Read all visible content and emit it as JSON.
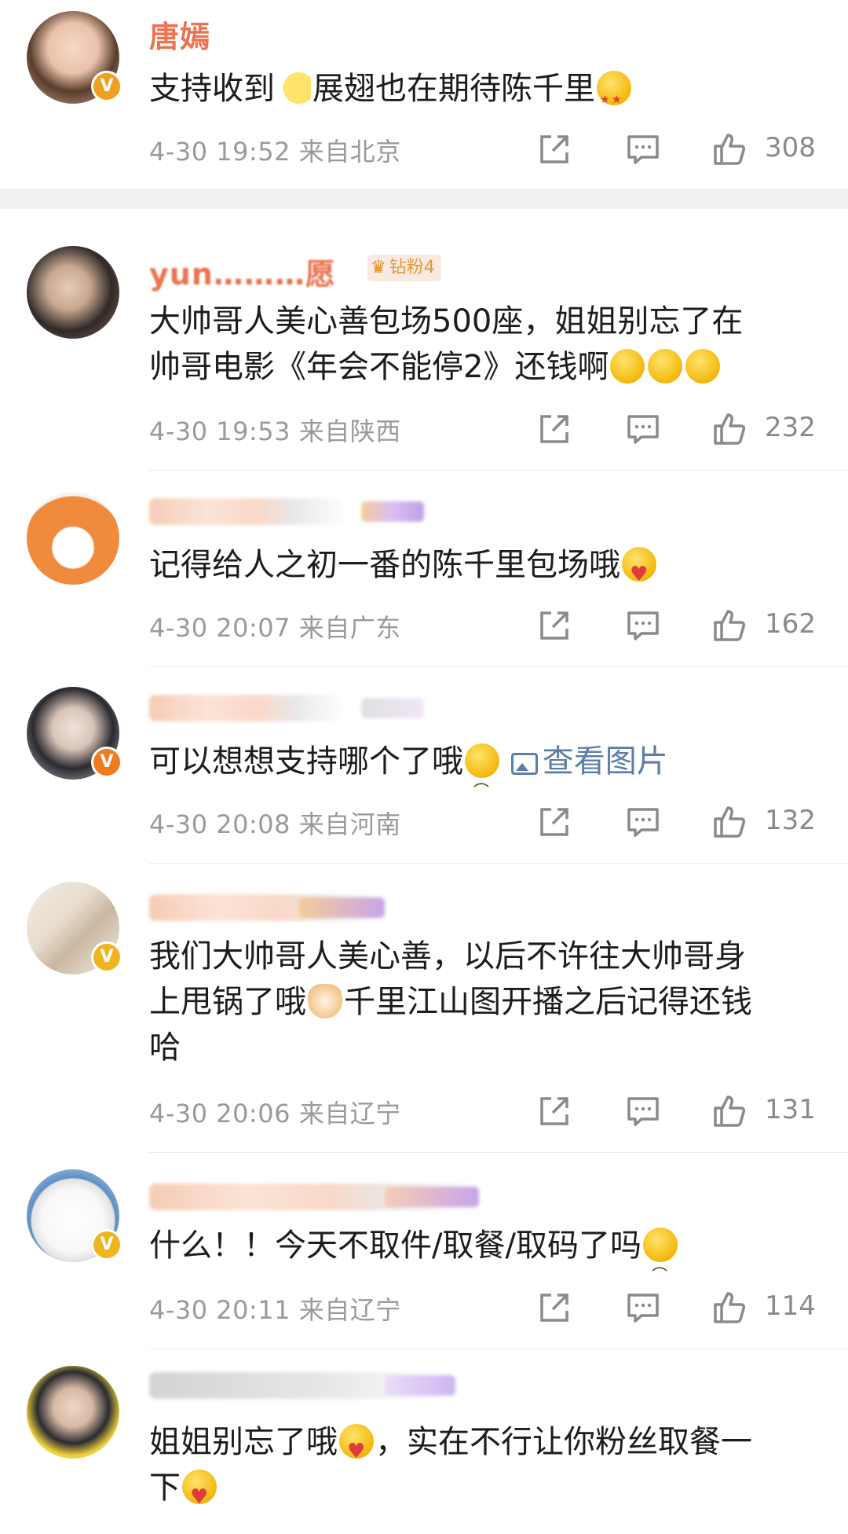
{
  "comments": [
    {
      "name": "唐嫣",
      "text_parts": [
        "支持收到",
        "展翅也在期待陈千里",
        ""
      ],
      "time": "4-30 19:52",
      "location": "来自北京",
      "likes": "308",
      "verified": true,
      "verified_color": "#f0a01e"
    },
    {
      "name": "yun………愿",
      "fan_badge": "钻粉4",
      "text_line1": "大帅哥人美心善包场500座，姐姐别忘了在",
      "text_line2": "帅哥电影《年会不能停2》还钱啊",
      "time": "4-30 19:53",
      "location": "来自陕西",
      "likes": "232"
    },
    {
      "text": "记得给人之初一番的陈千里包场哦",
      "time": "4-30 20:07",
      "location": "来自广东",
      "likes": "162"
    },
    {
      "text": "可以想想支持哪个了哦",
      "image_link": "查看图片",
      "time": "4-30 20:08",
      "location": "来自河南",
      "likes": "132",
      "verified_color": "#f07c1e"
    },
    {
      "text_line1": "我们大帅哥人美心善，以后不许往大帅哥身",
      "text_line2a": "上甩锅了哦",
      "text_line2b": "千里江山图开播之后记得还钱",
      "text_line3": "哈",
      "time": "4-30 20:06",
      "location": "来自辽宁",
      "likes": "131",
      "verified_color": "#f0b51e"
    },
    {
      "text": "什么！！今天不取件/取餐/取码了吗",
      "time": "4-30 20:11",
      "location": "来自辽宁",
      "likes": "114",
      "verified_color": "#f0b51e"
    },
    {
      "text_line1a": "姐姐别忘了哦",
      "text_line1b": "，实在不行让你粉丝取餐一",
      "text_line2": "下"
    }
  ],
  "icons": {
    "share": "share-icon",
    "comment": "comment-icon",
    "like": "thumbs-up-icon",
    "verified": "v-badge-icon"
  },
  "colors": {
    "name": "#eb7350",
    "meta": "#9a9a9a",
    "link": "#5b7ea8"
  }
}
